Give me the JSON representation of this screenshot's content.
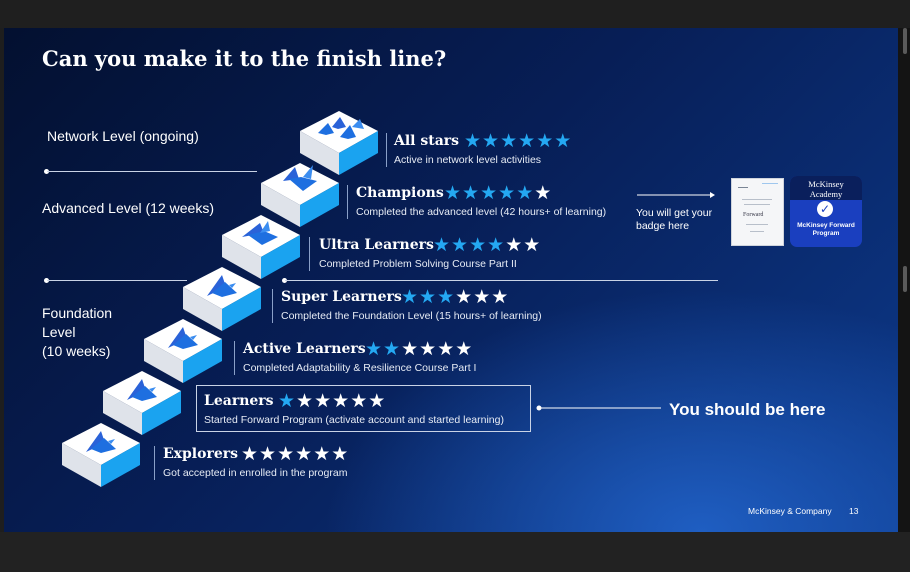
{
  "title": "Can you make it to the finish line?",
  "levels": [
    {
      "label": "Network Level (ongoing)"
    },
    {
      "label": "Advanced Level (12 weeks)"
    },
    {
      "label": "Foundation Level (10 weeks)",
      "lines": [
        "Foundation",
        "Level",
        "(10 weeks)"
      ]
    }
  ],
  "tiers": [
    {
      "name": "All stars",
      "stars_filled": 6,
      "stars_total": 6,
      "description": "Active in network level activities"
    },
    {
      "name": "Champions",
      "stars_filled": 5,
      "stars_total": 6,
      "description": "Completed the advanced level (42 hours+ of learning)"
    },
    {
      "name": "Ultra Learners",
      "stars_filled": 4,
      "stars_total": 6,
      "description": "Completed Problem Solving Course Part II"
    },
    {
      "name": "Super Learners",
      "stars_filled": 3,
      "stars_total": 6,
      "description": "Completed the Foundation Level (15 hours+ of learning)"
    },
    {
      "name": "Active Learners",
      "stars_filled": 2,
      "stars_total": 6,
      "description": "Completed Adaptability & Resilience Course Part I"
    },
    {
      "name": "Learners",
      "stars_filled": 1,
      "stars_total": 6,
      "description": "Started Forward Program (activate account and started learning)",
      "highlighted": true
    },
    {
      "name": "Explorers",
      "stars_filled": 0,
      "stars_total": 6,
      "description": "Got accepted in enrolled in the program"
    }
  ],
  "badge_callout": {
    "text": "You will get your badge here",
    "lines": [
      "You will get your",
      "badge here"
    ]
  },
  "certificate": {
    "word": "Forward"
  },
  "badge": {
    "top_text": "McKinsey Academy",
    "top_lines": [
      "McKinsey",
      "Academy"
    ],
    "bottom_text": "McKinsey Forward Program",
    "bottom_lines": [
      "McKinsey Forward",
      "Program"
    ]
  },
  "you_are_here": "You should be here",
  "footer": {
    "company": "McKinsey & Company",
    "page": "13"
  },
  "colors": {
    "star_active": "#24a8f2",
    "star_inactive": "#ffffff",
    "bird": "#1e6fe0",
    "slide_dark": "#031030",
    "slide_light": "#1f5ec2"
  },
  "icons": [
    "step-block-icon",
    "bird-icon",
    "arrow-right-icon",
    "arrow-left-icon",
    "check-icon"
  ]
}
